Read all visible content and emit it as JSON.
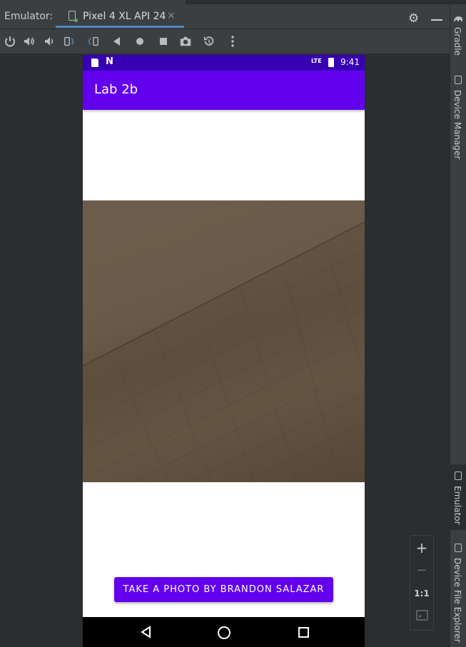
{
  "ide": {
    "tool_window_label": "Emulator:",
    "device_tab": "Pixel 4 XL API 24",
    "close_glyph": "×"
  },
  "toolbar": {
    "icons": [
      "power-icon",
      "volume-up-icon",
      "volume-down-icon",
      "rotate-left-icon",
      "rotate-right-icon",
      "back-icon",
      "home-icon",
      "overview-icon",
      "screenshot-icon",
      "snapshot-icon",
      "more-icon"
    ]
  },
  "side_tabs": {
    "gradle": "Gradle",
    "device_manager": "Device Manager",
    "emulator": "Emulator",
    "device_file_explorer": "Device File Explorer"
  },
  "status_bar": {
    "network": "LTE",
    "time": "9:41",
    "n_glyph": "N"
  },
  "app": {
    "title": "Lab 2b",
    "button_label": "TAKE A PHOTO BY BRANDON SALAZAR"
  },
  "zoom": {
    "plus": "+",
    "minus": "−",
    "one_to_one": "1:1"
  },
  "colors": {
    "primary": "#6200ee",
    "primary_dark": "#3700b3",
    "ide_bg": "#2b2d30",
    "accent_tab": "#4a88c7"
  }
}
